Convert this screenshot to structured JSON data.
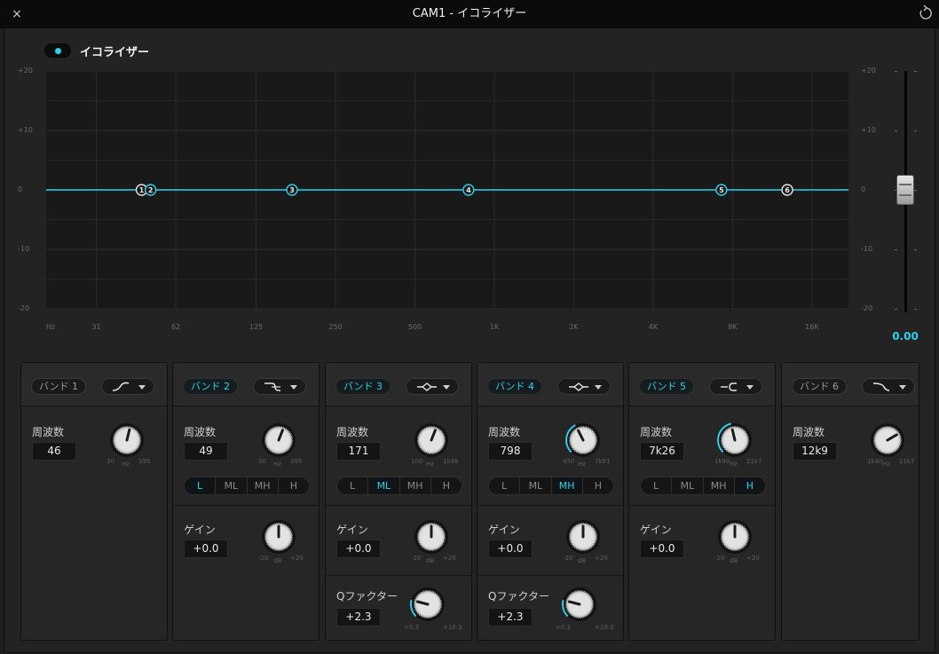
{
  "window": {
    "title": "CAM1 - イコライザー",
    "close": "×"
  },
  "equalizer": {
    "label": "イコライザー",
    "enabled": true,
    "accent": "#2ad2ee"
  },
  "graph": {
    "db_labels": [
      "+20",
      "+10",
      "0",
      "-10",
      "-20"
    ],
    "right_db_labels": [
      "+20",
      "+10",
      "0",
      "-10",
      "-20"
    ],
    "freq_labels": [
      "Hz",
      "31",
      "62",
      "125",
      "250",
      "500",
      "1K",
      "2K",
      "4K",
      "8K",
      "16K"
    ],
    "freq_ticks": [
      31,
      62,
      125,
      250,
      500,
      1000,
      2000,
      4000,
      8000,
      16000
    ],
    "freq_range": [
      20,
      22000
    ],
    "db_range": [
      -20,
      20
    ],
    "curve_db": 0,
    "nodes": [
      {
        "label": "1",
        "freq": 46,
        "db": 0,
        "active": false
      },
      {
        "label": "2",
        "freq": 49,
        "db": 0,
        "active": true
      },
      {
        "label": "3",
        "freq": 171,
        "db": 0,
        "active": true
      },
      {
        "label": "4",
        "freq": 798,
        "db": 0,
        "active": true
      },
      {
        "label": "5",
        "freq": 7260,
        "db": 0,
        "active": true
      },
      {
        "label": "6",
        "freq": 12900,
        "db": 0,
        "active": false
      }
    ]
  },
  "fader": {
    "value": "0.00",
    "level_db": 0
  },
  "lmh_options": [
    "L",
    "ML",
    "MH",
    "H"
  ],
  "bands": [
    {
      "label": "バンド 1",
      "active": false,
      "shape": "low-shelf-icon",
      "freq_label": "周波数",
      "freq_value": "46",
      "freq_min": "30",
      "freq_unit": "Hz",
      "freq_max": "395",
      "freq_level": 0.55
    },
    {
      "label": "バンド 2",
      "active": true,
      "shape": "low-shelf-ring-icon",
      "freq_label": "周波数",
      "freq_value": "49",
      "freq_min": "30",
      "freq_unit": "Hz",
      "freq_max": "395",
      "freq_level": 0.58,
      "lmh_selected": "L",
      "gain_label": "ゲイン",
      "gain_value": "+0.0",
      "gain_min": "-20",
      "gain_unit": "dB",
      "gain_max": "+20",
      "gain_level": 0.5
    },
    {
      "label": "バンド 3",
      "active": true,
      "shape": "bell-icon",
      "freq_label": "周波数",
      "freq_value": "171",
      "freq_min": "100",
      "freq_unit": "Hz",
      "freq_max": "1k48",
      "freq_level": 0.58,
      "lmh_selected": "ML",
      "gain_label": "ゲイン",
      "gain_value": "+0.0",
      "gain_min": "-20",
      "gain_unit": "dB",
      "gain_max": "+20",
      "gain_level": 0.5,
      "q_label": "Qファクター",
      "q_value": "+2.3",
      "q_min": "+0.3",
      "q_max": "+10.3",
      "q_level": 0.22
    },
    {
      "label": "バンド 4",
      "active": true,
      "shape": "bell-icon",
      "freq_label": "周波数",
      "freq_value": "798",
      "freq_min": "450",
      "freq_unit": "Hz",
      "freq_max": "7k91",
      "freq_level": 0.4,
      "lmh_selected": "MH",
      "gain_label": "ゲイン",
      "gain_value": "+0.0",
      "gain_min": "-20",
      "gain_unit": "dB",
      "gain_max": "+20",
      "gain_level": 0.5,
      "q_label": "Qファクター",
      "q_value": "+2.3",
      "q_min": "+0.3",
      "q_max": "+10.3",
      "q_level": 0.22
    },
    {
      "label": "バンド 5",
      "active": true,
      "shape": "high-shelf-ring-icon",
      "freq_label": "周波数",
      "freq_value": "7k26",
      "freq_min": "1k40",
      "freq_unit": "Hz",
      "freq_max": "21k7",
      "freq_level": 0.45,
      "lmh_selected": "H",
      "gain_label": "ゲイン",
      "gain_value": "+0.0",
      "gain_min": "-20",
      "gain_unit": "dB",
      "gain_max": "+20",
      "gain_level": 0.5
    },
    {
      "label": "バンド 6",
      "active": false,
      "shape": "high-shelf-icon",
      "freq_label": "周波数",
      "freq_value": "12k9",
      "freq_min": "1k40",
      "freq_unit": "Hz",
      "freq_max": "21k7",
      "freq_level": 0.72
    }
  ]
}
